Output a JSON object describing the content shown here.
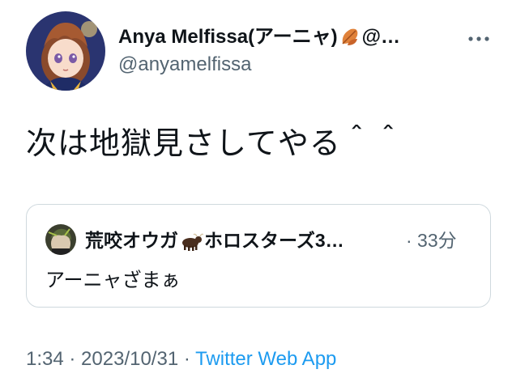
{
  "author": {
    "display_name": "Anya Melfissa(アーニャ)",
    "name_suffix": "@…",
    "handle": "@anyamelfissa"
  },
  "tweet": {
    "text": "次は地獄見さしてやる＾＾"
  },
  "quoted_tweet": {
    "display_name_prefix": "荒咬オウガ",
    "display_name_suffix": "ホロスターズ3…",
    "time": "· 33分",
    "text": "アーニャざまぁ"
  },
  "meta": {
    "time": "1:34",
    "separator1": " · ",
    "date": "2023/10/31",
    "separator2": " · ",
    "source": "Twitter Web App"
  },
  "icons": {
    "more": "more-horizontal-icon",
    "leaf": "fallen-leaf-emoji",
    "ox": "ox-emoji"
  },
  "colors": {
    "text_primary": "#0f1419",
    "text_secondary": "#536471",
    "link": "#1d9bf0",
    "border": "#cfd9de"
  }
}
